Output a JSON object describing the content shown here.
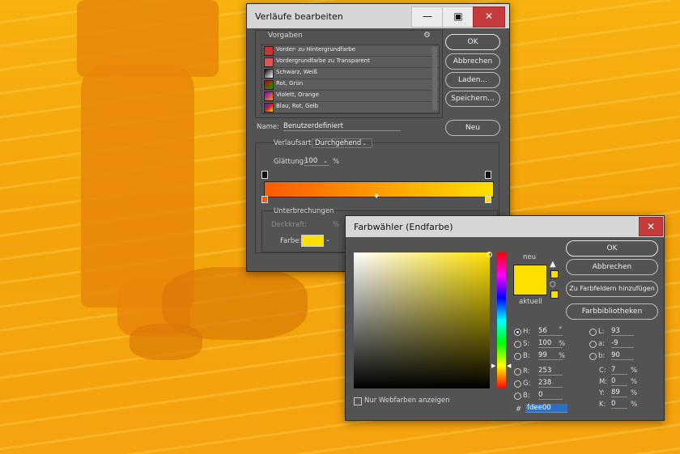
{
  "gradient_editor": {
    "title": "Verläufe bearbeiten",
    "window_buttons": {
      "minimize": "—",
      "maximize": "▣",
      "close": "✕"
    },
    "presets_label": "Vorgaben",
    "presets": [
      {
        "name": "Vorder- zu Hintergrundfarbe",
        "swatch": "#c33"
      },
      {
        "name": "Vordergrundfarbe zu Transparent",
        "swatch": "#d55"
      },
      {
        "name": "Schwarz, Weiß",
        "swatch": "#777"
      },
      {
        "name": "Rot, Grün",
        "swatch": "#7a4a1a"
      },
      {
        "name": "Violett, Orange",
        "swatch": "#8b3fa0"
      },
      {
        "name": "Blau, Rot, Gelb",
        "swatch": "#3c56c8"
      }
    ],
    "buttons": {
      "ok": "OK",
      "cancel": "Abbrechen",
      "load": "Laden...",
      "save": "Speichern...",
      "new": "Neu"
    },
    "name_label": "Name:",
    "name_value": "Benutzerdefiniert",
    "type_label": "Verlaufsart:",
    "type_value": "Durchgehend",
    "smooth_label": "Glättung:",
    "smooth_value": "100",
    "smooth_unit": "%",
    "stops_label": "Unterbrechungen",
    "opacity_label": "Deckkraft:",
    "opacity_unit": "%",
    "color_label": "Farbe:",
    "gradient_start": "#fb5a03",
    "gradient_end": "#fde000"
  },
  "color_picker": {
    "title": "Farbwähler (Endfarbe)",
    "close_icon": "✕",
    "buttons": {
      "ok": "OK",
      "cancel": "Abbrechen",
      "add_swatch": "Zu Farbfeldern hinzufügen",
      "libraries": "Farbbibliotheken"
    },
    "new_label": "neu",
    "current_label": "aktuell",
    "new_color": "#fde000",
    "current_color": "#fde000",
    "web_only_label": "Nur Webfarben anzeigen",
    "fields": {
      "H": {
        "label": "H:",
        "value": "56",
        "unit": "°"
      },
      "S": {
        "label": "S:",
        "value": "100",
        "unit": "%"
      },
      "B": {
        "label": "B:",
        "value": "99",
        "unit": "%"
      },
      "R": {
        "label": "R:",
        "value": "253"
      },
      "G": {
        "label": "G:",
        "value": "238"
      },
      "Bv": {
        "label": "B:",
        "value": "0"
      },
      "L": {
        "label": "L:",
        "value": "93"
      },
      "a": {
        "label": "a:",
        "value": "-9"
      },
      "b": {
        "label": "b:",
        "value": "90"
      },
      "C": {
        "label": "C:",
        "value": "7",
        "unit": "%"
      },
      "M": {
        "label": "M:",
        "value": "0",
        "unit": "%"
      },
      "Y": {
        "label": "Y:",
        "value": "89",
        "unit": "%"
      },
      "K": {
        "label": "K:",
        "value": "0",
        "unit": "%"
      }
    },
    "hex_label": "#",
    "hex_value": "fdee00"
  }
}
